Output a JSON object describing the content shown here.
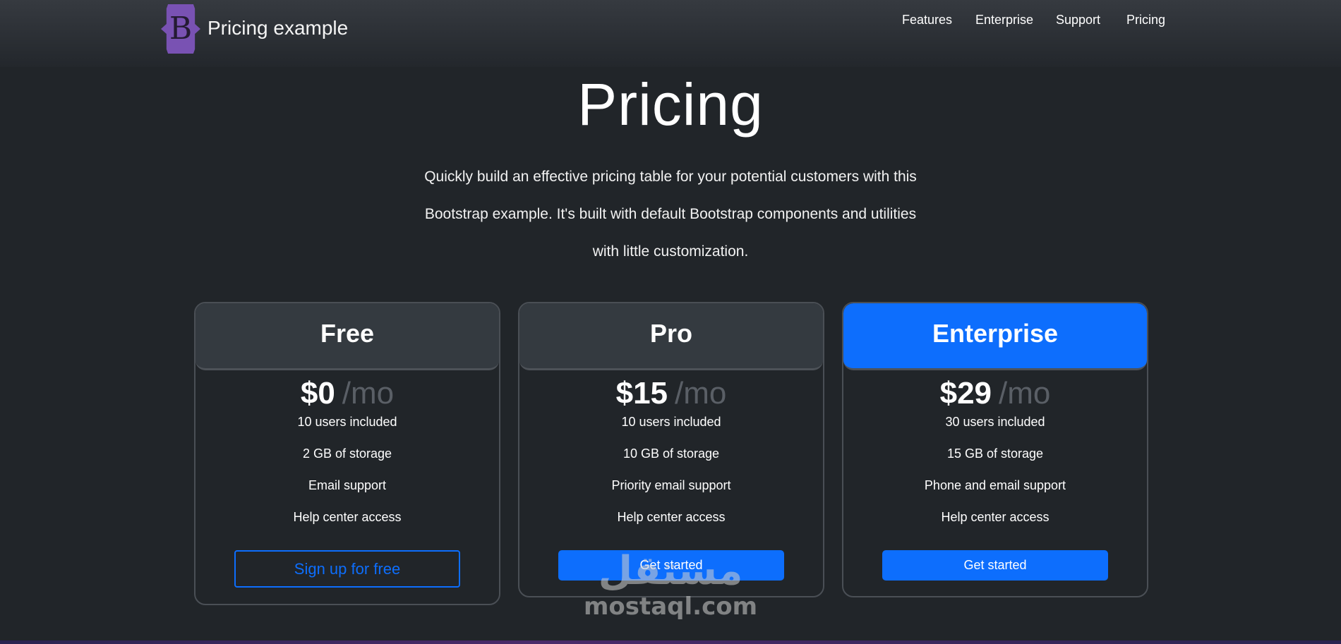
{
  "header": {
    "logo_letter": "B",
    "logo_color": "#7952b3",
    "brand_title": "Pricing example",
    "nav": [
      {
        "label": "Features"
      },
      {
        "label": "Enterprise"
      },
      {
        "label": "Support"
      },
      {
        "label": "Pricing"
      }
    ]
  },
  "hero": {
    "title": "Pricing",
    "lead": "Quickly build an effective pricing table for your potential customers with this Bootstrap example. It's built with default Bootstrap components and utilities with little customization."
  },
  "plans": [
    {
      "name": "Free",
      "price": "$0",
      "period": "/mo",
      "features": [
        "10 users included",
        "2 GB of storage",
        "Email support",
        "Help center access"
      ],
      "button_label": "Sign up for free",
      "button_style": "outline",
      "header_style": "default"
    },
    {
      "name": "Pro",
      "price": "$15",
      "period": "/mo",
      "features": [
        "10 users included",
        "10 GB of storage",
        "Priority email support",
        "Help center access"
      ],
      "button_label": "Get started",
      "button_style": "solid",
      "header_style": "default"
    },
    {
      "name": "Enterprise",
      "price": "$29",
      "period": "/mo",
      "features": [
        "30 users included",
        "15 GB of storage",
        "Phone and email support",
        "Help center access"
      ],
      "button_label": "Get started",
      "button_style": "solid",
      "header_style": "primary"
    }
  ],
  "watermark": {
    "arabic": "مستقل",
    "latin": "mostaql.com"
  },
  "colors": {
    "background": "#212529",
    "primary": "#0d6efd",
    "card_header": "#343a40",
    "muted": "#5a5f66"
  }
}
